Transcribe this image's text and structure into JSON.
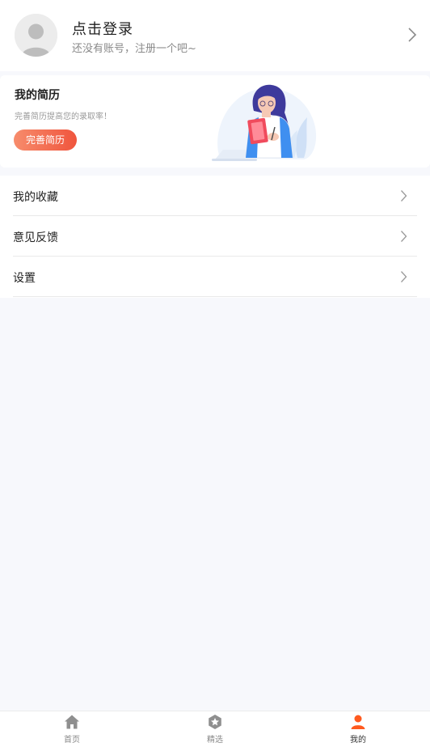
{
  "login": {
    "title": "点击登录",
    "subtitle": "还没有账号，注册一个吧~"
  },
  "resume": {
    "title": "我的简历",
    "subtitle": "完善简历提高您的录取率！",
    "button_label": "完善简历"
  },
  "menu": {
    "items": [
      {
        "label": "我的收藏"
      },
      {
        "label": "意见反馈"
      },
      {
        "label": "设置"
      }
    ]
  },
  "tabbar": {
    "tabs": [
      {
        "label": "首页",
        "icon": "home-icon"
      },
      {
        "label": "精选",
        "icon": "featured-star-icon"
      },
      {
        "label": "我的",
        "icon": "user-icon"
      }
    ],
    "active_index": 2,
    "active_color": "#ff5a1f",
    "inactive_color": "#9a9a9a"
  },
  "colors": {
    "accent_gradient_start": "#f78c6c",
    "accent_gradient_end": "#f0553d",
    "background": "#f7f8fc"
  }
}
